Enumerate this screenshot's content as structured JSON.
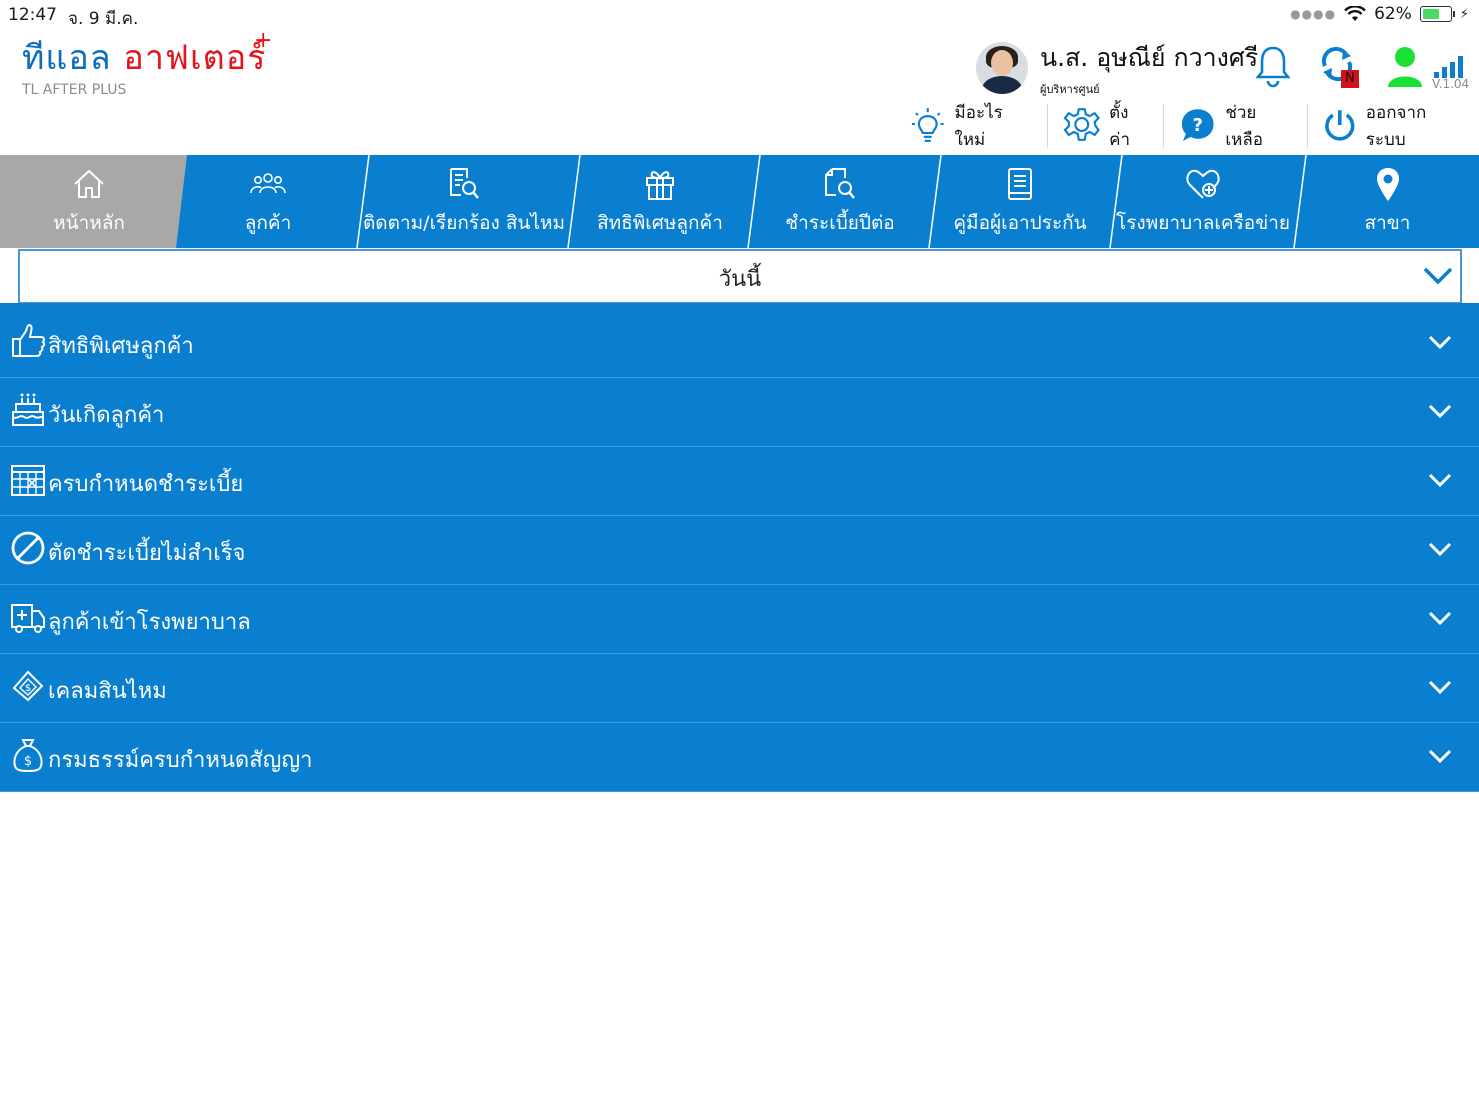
{
  "status": {
    "time": "12:47",
    "date": "จ. 9 มี.ค.",
    "battery": "62%",
    "battery_level": 0.62
  },
  "app": {
    "logo_th_a": "ทีแอล",
    "logo_th_b": "อาฟเตอร์",
    "logo_plus": "+",
    "logo_en": "TL AFTER PLUS",
    "version": "V.1.04"
  },
  "user": {
    "name": "น.ส. อุษณีย์ กวางศรี",
    "role": "ผู้บริหารศูนย์",
    "sync_badge": "N"
  },
  "toolbar": [
    {
      "label": "มีอะไรใหม่",
      "icon": "lightbulb-icon"
    },
    {
      "label": "ตั้งค่า",
      "icon": "gear-icon"
    },
    {
      "label": "ช่วยเหลือ",
      "icon": "help-icon"
    },
    {
      "label": "ออกจากระบบ",
      "icon": "power-icon"
    }
  ],
  "nav": [
    {
      "label": "หน้าหลัก",
      "icon": "home-icon",
      "active": true
    },
    {
      "label": "ลูกค้า",
      "icon": "group-icon"
    },
    {
      "label": "ติดตาม/เรียกร้อง สินไหม",
      "icon": "document-search-icon"
    },
    {
      "label": "สิทธิพิเศษลูกค้า",
      "icon": "gift-icon"
    },
    {
      "label": "ชำระเบี้ยปีต่อ",
      "icon": "payment-search-icon"
    },
    {
      "label": "คู่มือผู้เอาประกัน",
      "icon": "book-icon"
    },
    {
      "label": "โรงพยาบาลเครือข่าย",
      "icon": "heart-plus-icon"
    },
    {
      "label": "สาขา",
      "icon": "map-pin-icon"
    }
  ],
  "period_select": {
    "value": "วันนี้"
  },
  "sections": [
    {
      "label": "สิทธิพิเศษลูกค้า",
      "icon": "thumbs-up-icon"
    },
    {
      "label": "วันเกิดลูกค้า",
      "icon": "birthday-cake-icon"
    },
    {
      "label": "ครบกำหนดชำระเบี้ย",
      "icon": "calendar-icon"
    },
    {
      "label": "ตัดชำระเบี้ยไม่สำเร็จ",
      "icon": "prohibited-icon"
    },
    {
      "label": "ลูกค้าเข้าโรงพยาบาล",
      "icon": "ambulance-icon"
    },
    {
      "label": "เคลมสินไหม",
      "icon": "claim-ticket-icon"
    },
    {
      "label": "กรมธรรม์ครบกำหนดสัญญา",
      "icon": "money-bag-icon"
    }
  ],
  "colors": {
    "primary": "#0a7fd0",
    "active_tab": "#a8a8a8",
    "brand_red": "#e3141c",
    "brand_blue": "#0b6cc0"
  }
}
